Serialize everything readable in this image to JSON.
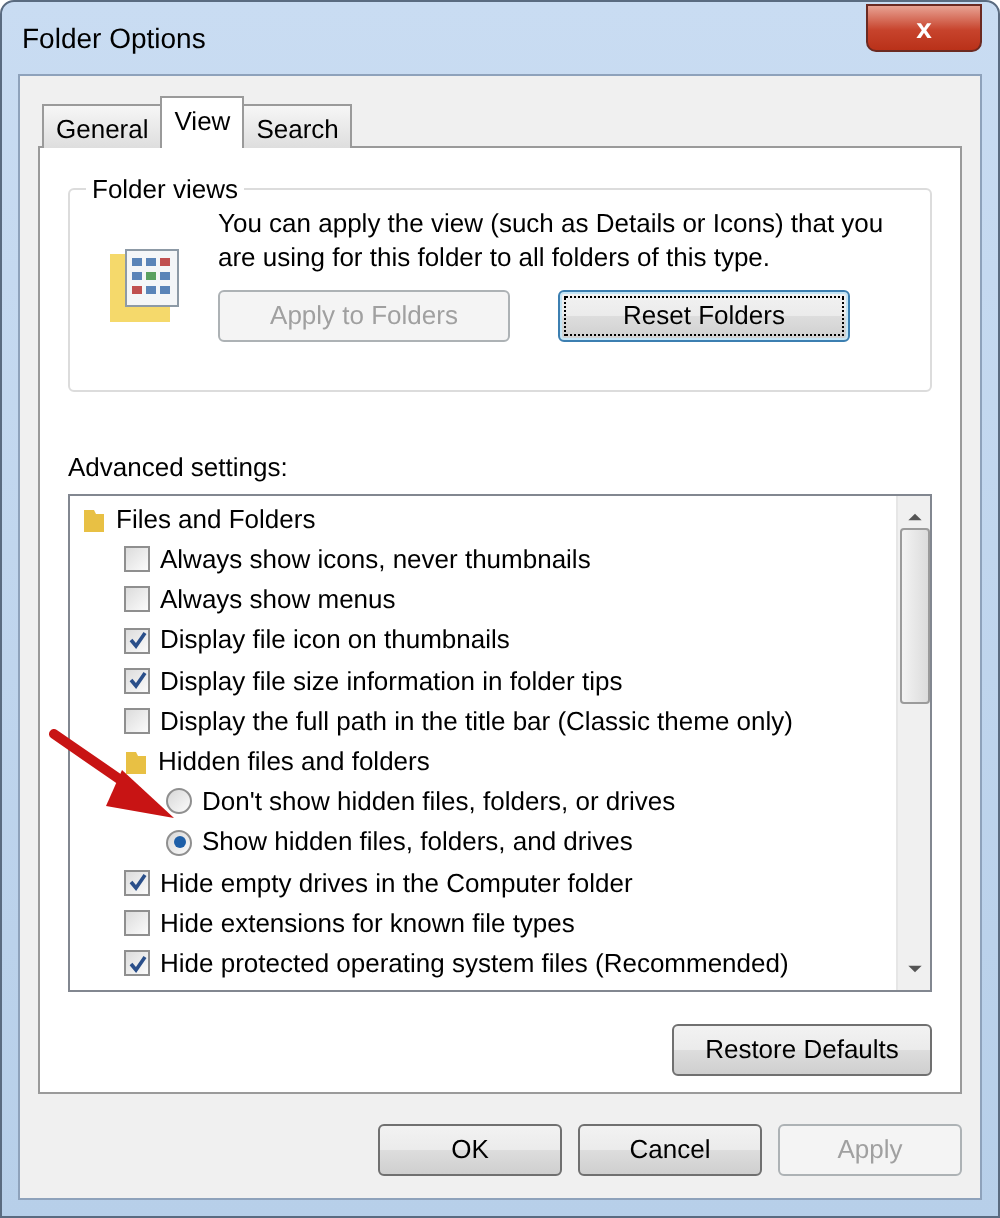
{
  "window": {
    "title": "Folder Options",
    "close_label": "x"
  },
  "tabs": [
    {
      "label": "General",
      "selected": false
    },
    {
      "label": "View",
      "selected": true
    },
    {
      "label": "Search",
      "selected": false
    }
  ],
  "folder_views": {
    "title": "Folder views",
    "description": "You can apply the view (such as Details or Icons) that you are using for this folder to all folders of this type.",
    "buttons": [
      {
        "label": "Apply to Folders",
        "disabled": true,
        "focused": false
      },
      {
        "label": "Reset Folders",
        "disabled": false,
        "focused": true
      }
    ]
  },
  "advanced_settings": {
    "label": "Advanced settings:",
    "items": [
      {
        "kind": "folder",
        "label": "Files and Folders",
        "children": [
          {
            "kind": "checkbox",
            "label": "Always show icons, never thumbnails",
            "checked": false
          },
          {
            "kind": "checkbox",
            "label": "Always show menus",
            "checked": false
          },
          {
            "kind": "checkbox",
            "label": "Display file icon on thumbnails",
            "checked": true
          },
          {
            "kind": "checkbox",
            "label": "Display file size information in folder tips",
            "checked": true
          },
          {
            "kind": "checkbox",
            "label": "Display the full path in the title bar (Classic theme only)",
            "checked": false
          },
          {
            "kind": "folder",
            "label": "Hidden files and folders",
            "children": [
              {
                "kind": "radio",
                "label": "Don't show hidden files, folders, or drives",
                "selected": false
              },
              {
                "kind": "radio",
                "label": "Show hidden files, folders, and drives",
                "selected": true
              }
            ]
          },
          {
            "kind": "checkbox",
            "label": "Hide empty drives in the Computer folder",
            "checked": true
          },
          {
            "kind": "checkbox",
            "label": "Hide extensions for known file types",
            "checked": false
          },
          {
            "kind": "checkbox",
            "label": "Hide protected operating system files (Recommended)",
            "checked": true
          }
        ]
      }
    ]
  },
  "restore_button": {
    "label": "Restore Defaults"
  },
  "dialog_buttons": [
    {
      "label": "OK",
      "disabled": false
    },
    {
      "label": "Cancel",
      "disabled": false
    },
    {
      "label": "Apply",
      "disabled": true
    }
  ]
}
